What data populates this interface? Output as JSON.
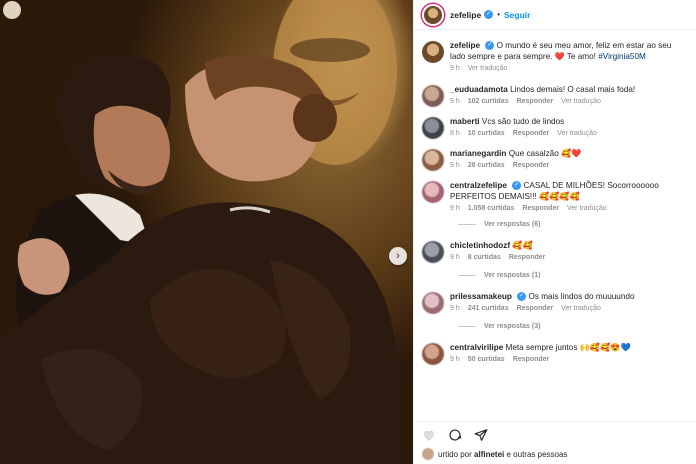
{
  "post": {
    "username": "zefelipe",
    "follow_label": "Seguir",
    "separator": "•"
  },
  "caption": {
    "username": "zefelipe",
    "text": "O mundo é seu meu amor, feliz em estar ao seu lado sempre e para sempre.",
    "heart": "❤️",
    "text2": "Te amo!",
    "hashtag": "#Virginia50M",
    "time": "9 h",
    "translate": "Ver tradução"
  },
  "comments": [
    {
      "username": "_euduadamota",
      "text": "Lindos demais! O casal mais foda!",
      "time": "9 h",
      "likes": "102 curtidas",
      "reply": "Responder",
      "translate": "Ver tradução",
      "verified": false,
      "replies": ""
    },
    {
      "username": "maberti",
      "text": "Vcs são tudo de lindos",
      "time": "8 h",
      "likes": "10 curtidas",
      "reply": "Responder",
      "translate": "Ver tradução",
      "verified": false,
      "replies": ""
    },
    {
      "username": "marianegardin",
      "text": "Que casalzão 🥰❤️",
      "time": "9 h",
      "likes": "28 curtidas",
      "reply": "Responder",
      "translate": "",
      "verified": false,
      "replies": ""
    },
    {
      "username": "centralzefelipe",
      "text": "CASAL DE MILHÕES! Socorroooooo PERFEITOS DEMAIS!!! 🥰🥰🥰🥰",
      "time": "9 h",
      "likes": "1.058 curtidas",
      "reply": "Responder",
      "translate": "Ver tradução",
      "verified": true,
      "replies": "Ver respostas (6)"
    },
    {
      "username": "chicletinhodozf",
      "text": "🥰🥰",
      "time": "9 h",
      "likes": "8 curtidas",
      "reply": "Responder",
      "translate": "",
      "verified": false,
      "replies": "Ver respostas (1)"
    },
    {
      "username": "prilessamakeup",
      "text": "Os mais lindos do muuuundo",
      "time": "9 h",
      "likes": "241 curtidas",
      "reply": "Responder",
      "translate": "Ver tradução",
      "verified": true,
      "replies": "Ver respostas (3)"
    },
    {
      "username": "centralvirilipe",
      "text": "Meta sempre juntos 🙌🥰🥰😍💙",
      "time": "9 h",
      "likes": "50 curtidas",
      "reply": "Responder",
      "translate": "",
      "verified": false,
      "replies": ""
    }
  ],
  "footer": {
    "liked_text": "urtido por",
    "liked_user": "alfinetei",
    "liked_rest": "e outras pessoas"
  },
  "icons": {
    "like": "heart-icon",
    "comment": "comment-icon",
    "share": "share-icon",
    "verified": "verified-badge-icon",
    "next": "chevron-right-icon"
  },
  "colors": {
    "follow": "#0095f6",
    "verified": "#3897f0",
    "muted": "#8e8e8e",
    "hashtag": "#00376b"
  }
}
